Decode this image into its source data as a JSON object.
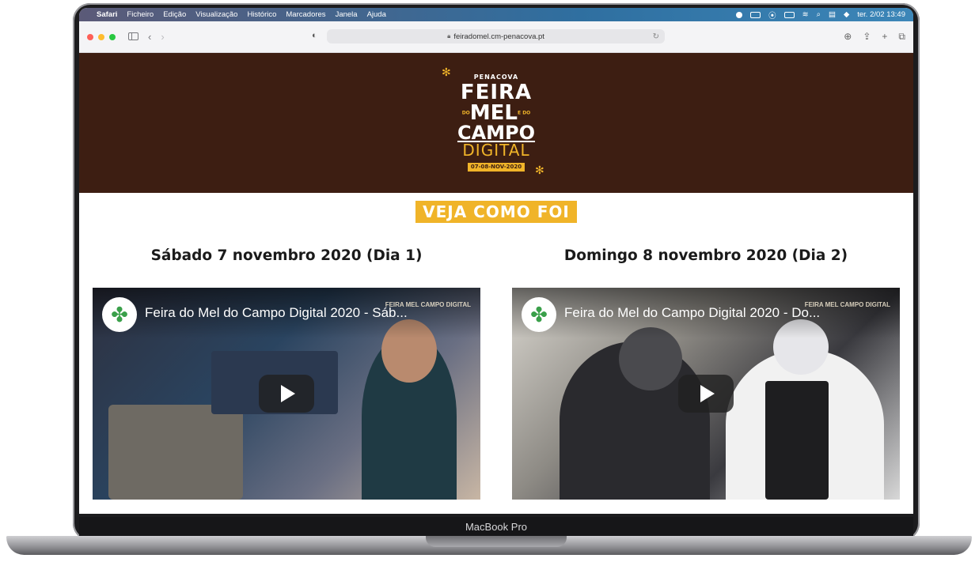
{
  "menubar": {
    "app": "Safari",
    "items": [
      "Ficheiro",
      "Edição",
      "Visualização",
      "Histórico",
      "Marcadores",
      "Janela",
      "Ajuda"
    ],
    "clock": "ter. 2/02  13:49"
  },
  "browser": {
    "url": "feiradomel.cm-penacova.pt"
  },
  "header": {
    "logo": {
      "top": "PENACOVA",
      "line1": "FEIRA",
      "small_left": "DO",
      "line2": "MEL",
      "small_right": "E DO",
      "line3": "CAMPO",
      "line4": "DIGITAL",
      "dates": "07-08-NOV-2020"
    }
  },
  "badge": "VEJA COMO FOI",
  "days": [
    {
      "heading": "Sábado 7 novembro 2020 (Dia 1)",
      "video_title": "Feira do Mel do Campo Digital 2020 - Sáb...",
      "video_logo": "FEIRA MEL CAMPO DIGITAL"
    },
    {
      "heading": "Domingo 8 novembro 2020 (Dia 2)",
      "video_title": "Feira do Mel do Campo Digital 2020 - Do...",
      "video_logo": "FEIRA MEL CAMPO DIGITAL"
    }
  ],
  "device_label": "MacBook Pro",
  "colors": {
    "header_bg": "#3d1e12",
    "accent": "#f0b429"
  }
}
